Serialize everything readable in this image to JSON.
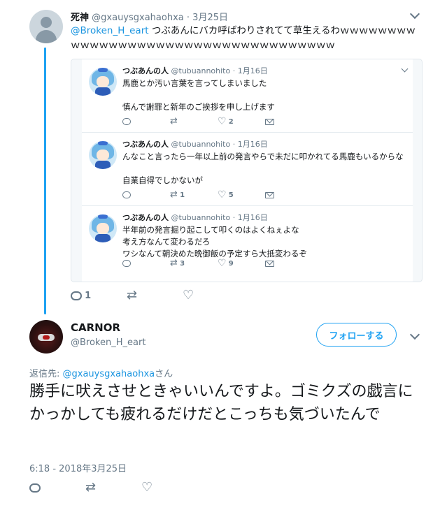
{
  "reply_tweet": {
    "name": "死神",
    "handle": "@gxauysgxahaohxa",
    "dot": "·",
    "time": "3月25日",
    "mention": "@Broken_H_eart",
    "text": " つぶあんにバカ呼ばわりされてて草生えるわｗｗｗｗｗｗｗｗｗｗｗｗｗｗｗｗｗｗｗｗｗｗｗｗｗｗｗｗｗｗｗｗｗｗｗｗ",
    "actions": {
      "reply_count": "1",
      "retweet_count": "",
      "like_count": ""
    }
  },
  "quoted_tweets": [
    {
      "name": "つぶあんの人",
      "handle": "@tubuannohito",
      "dot": "·",
      "time": "1月16日",
      "text": "馬鹿とか汚い言葉を言ってしまいました\n\n慎んで謝罪と新年のご挨拶を申し上げます",
      "reply_count": "",
      "retweet_count": "",
      "like_count": "2"
    },
    {
      "name": "つぶあんの人",
      "handle": "@tubuannohito",
      "dot": "·",
      "time": "1月16日",
      "text": "んなこと言ったら一年以上前の発言やらで未だに叩かれてる馬鹿もいるからな\n\n自業自得でしかないが",
      "reply_count": "",
      "retweet_count": "1",
      "like_count": "5"
    },
    {
      "name": "つぶあんの人",
      "handle": "@tubuannohito",
      "dot": "·",
      "time": "1月16日",
      "text": "半年前の発言掘り起こして叩くのはよくねぇよな\n考え方なんて変わるだろ\nワシなんて朝決めた晩御飯の予定すら大抵変わるぞ",
      "reply_count": "",
      "retweet_count": "3",
      "like_count": "9"
    }
  ],
  "main_tweet": {
    "name": "CARNOR",
    "handle": "@Broken_H_eart",
    "follow_label": "フォローする",
    "replying_prefix": "返信先: ",
    "replying_mention": "@gxauysgxahaohxa",
    "replying_suffix": "さん",
    "text": "勝手に吠えさせときゃいいんですよ。ゴミクズの戯言にかっかしても疲れるだけだとこっちも気づいたんで",
    "timestamp": "6:18 - 2018年3月25日"
  },
  "icons": {
    "reply": "reply-icon",
    "retweet": "retweet-icon",
    "like": "heart-icon",
    "dm": "envelope-icon",
    "more": "chevron-down-icon"
  },
  "colors": {
    "accent": "#1da1f2",
    "link": "#1b95e0",
    "muted": "#657786",
    "text": "#14171a",
    "border": "#e1e8ed"
  }
}
